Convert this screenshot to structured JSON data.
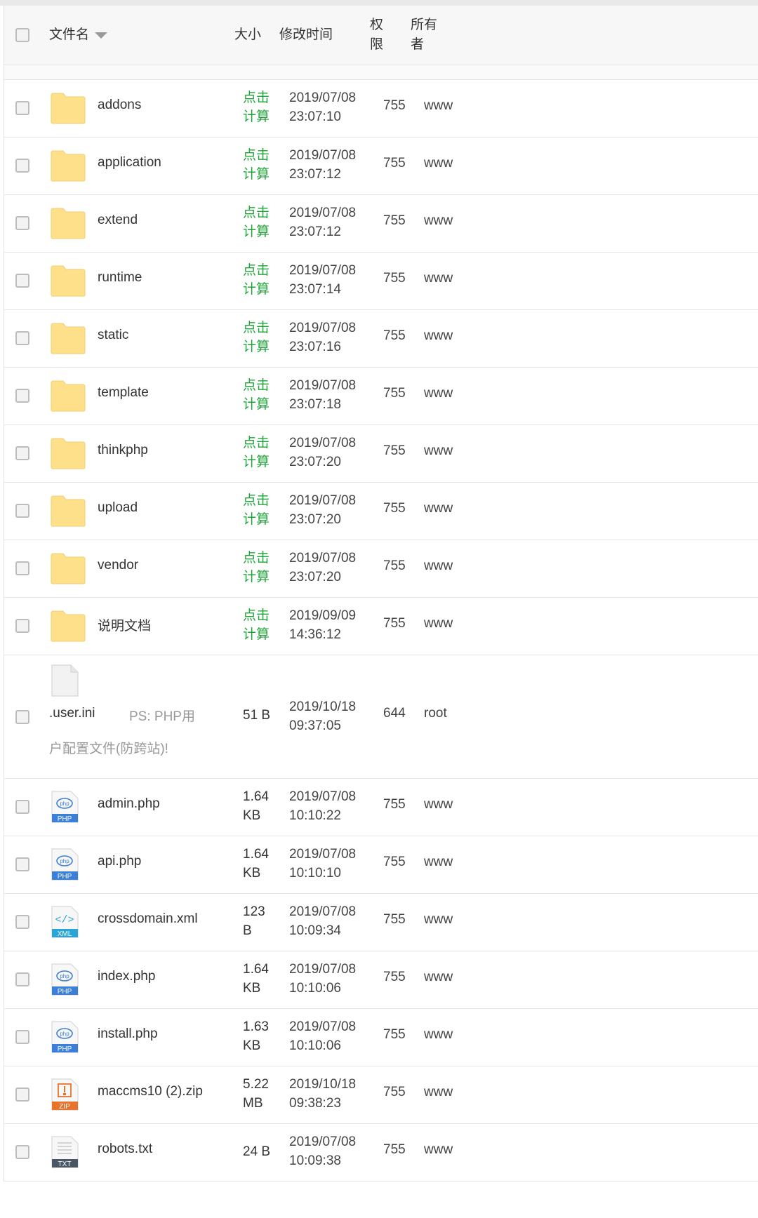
{
  "header": {
    "name": "文件名",
    "size": "大小",
    "mtime": "修改时间",
    "perm": "权限",
    "owner": "所有者"
  },
  "rows": [
    {
      "type": "folder",
      "name": "addons",
      "size1": "点击",
      "size2": "计算",
      "date": "2019/07/08",
      "time": "23:07:10",
      "perm": "755",
      "owner": "www"
    },
    {
      "type": "folder",
      "name": "application",
      "size1": "点击",
      "size2": "计算",
      "date": "2019/07/08",
      "time": "23:07:12",
      "perm": "755",
      "owner": "www"
    },
    {
      "type": "folder",
      "name": "extend",
      "size1": "点击",
      "size2": "计算",
      "date": "2019/07/08",
      "time": "23:07:12",
      "perm": "755",
      "owner": "www"
    },
    {
      "type": "folder",
      "name": "runtime",
      "size1": "点击",
      "size2": "计算",
      "date": "2019/07/08",
      "time": "23:07:14",
      "perm": "755",
      "owner": "www"
    },
    {
      "type": "folder",
      "name": "static",
      "size1": "点击",
      "size2": "计算",
      "date": "2019/07/08",
      "time": "23:07:16",
      "perm": "755",
      "owner": "www"
    },
    {
      "type": "folder",
      "name": "template",
      "size1": "点击",
      "size2": "计算",
      "date": "2019/07/08",
      "time": "23:07:18",
      "perm": "755",
      "owner": "www"
    },
    {
      "type": "folder",
      "name": "thinkphp",
      "size1": "点击",
      "size2": "计算",
      "date": "2019/07/08",
      "time": "23:07:20",
      "perm": "755",
      "owner": "www"
    },
    {
      "type": "folder",
      "name": "upload",
      "size1": "点击",
      "size2": "计算",
      "date": "2019/07/08",
      "time": "23:07:20",
      "perm": "755",
      "owner": "www"
    },
    {
      "type": "folder",
      "name": "vendor",
      "size1": "点击",
      "size2": "计算",
      "date": "2019/07/08",
      "time": "23:07:20",
      "perm": "755",
      "owner": "www"
    },
    {
      "type": "folder",
      "name": "说明文档",
      "size1": "点击",
      "size2": "计算",
      "date": "2019/09/09",
      "time": "14:36:12",
      "perm": "755",
      "owner": "www"
    },
    {
      "type": "ini",
      "name": ".user.ini",
      "note1": "PS: PHP用",
      "note2": "户配置文件(防跨站)!",
      "size1": "51 B",
      "size2": "",
      "date": "2019/10/18",
      "time": "09:37:05",
      "perm": "644",
      "owner": "root"
    },
    {
      "type": "php",
      "name": "admin.php",
      "size1": "1.64",
      "size2": "KB",
      "date": "2019/07/08",
      "time": "10:10:22",
      "perm": "755",
      "owner": "www"
    },
    {
      "type": "php",
      "name": "api.php",
      "size1": "1.64",
      "size2": "KB",
      "date": "2019/07/08",
      "time": "10:10:10",
      "perm": "755",
      "owner": "www"
    },
    {
      "type": "xml",
      "name": "crossdomain.xml",
      "size1": "123",
      "size2": "B",
      "date": "2019/07/08",
      "time": "10:09:34",
      "perm": "755",
      "owner": "www"
    },
    {
      "type": "php",
      "name": "index.php",
      "size1": "1.64",
      "size2": "KB",
      "date": "2019/07/08",
      "time": "10:10:06",
      "perm": "755",
      "owner": "www"
    },
    {
      "type": "php",
      "name": "install.php",
      "size1": "1.63",
      "size2": "KB",
      "date": "2019/07/08",
      "time": "10:10:06",
      "perm": "755",
      "owner": "www"
    },
    {
      "type": "zip",
      "name": "maccms10 (2).zip",
      "size1": "5.22",
      "size2": "MB",
      "date": "2019/10/18",
      "time": "09:38:23",
      "perm": "755",
      "owner": "www"
    },
    {
      "type": "txt",
      "name": "robots.txt",
      "size1": "24 B",
      "size2": "",
      "date": "2019/07/08",
      "time": "10:09:38",
      "perm": "755",
      "owner": "www"
    }
  ],
  "icon_labels": {
    "php": "PHP",
    "xml": "XML",
    "zip": "ZIP",
    "txt": "TXT"
  },
  "colors": {
    "green": "#20a53a",
    "folder": "#ffe08a",
    "php": "#3c7fd8",
    "xml": "#2aa6d6",
    "zip": "#e8742b",
    "txt": "#4a5866"
  }
}
